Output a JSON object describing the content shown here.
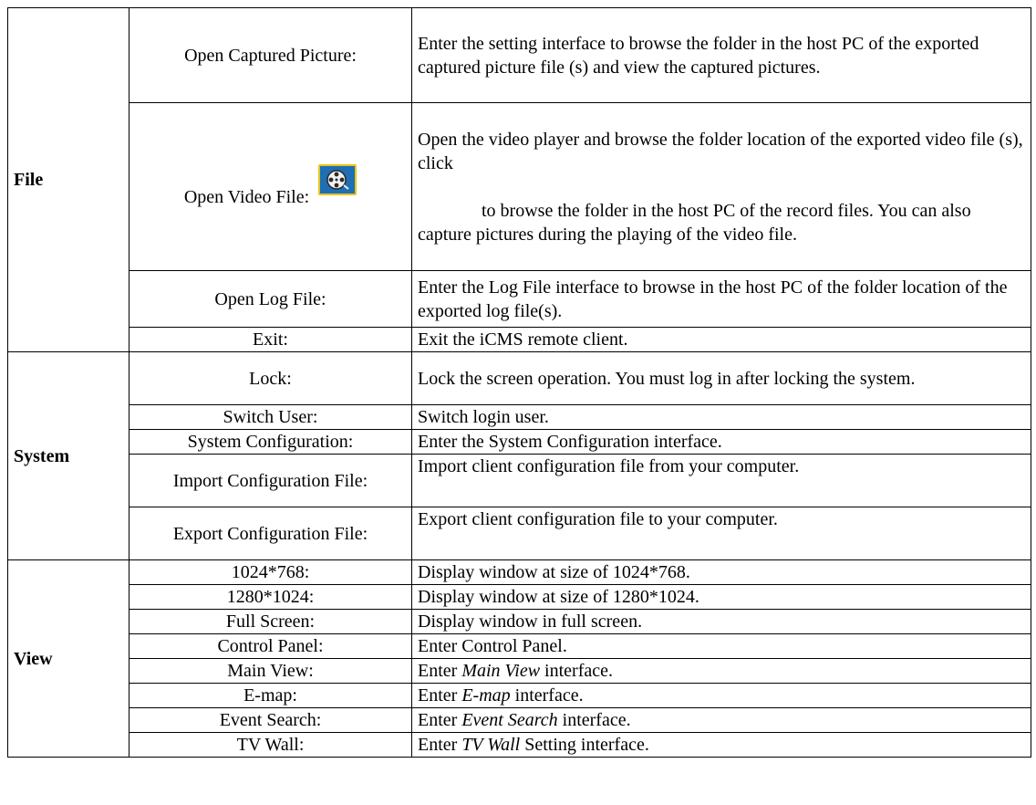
{
  "sections": {
    "file": {
      "title": "File",
      "rows": [
        {
          "item": "Open Captured Picture:",
          "desc": "Enter the setting interface to browse the folder in the host PC of the exported captured picture file (s) and view the captured pictures."
        },
        {
          "item": "Open Video File:",
          "desc_a": "Open the video player and browse the folder location of the exported video file (s), click",
          "desc_b": "to browse the folder in the host PC of the record files. You can also capture pictures during the playing of the video file.",
          "icon": "video-file-icon"
        },
        {
          "item": "Open Log File:",
          "desc": "Enter the Log File interface to browse in the host PC of the folder location of the exported log file(s)."
        },
        {
          "item": "Exit:",
          "desc": "Exit the iCMS remote client."
        }
      ]
    },
    "system": {
      "title": "System",
      "rows": [
        {
          "item": "Lock:",
          "desc": "Lock the screen operation. You must log in after locking the system."
        },
        {
          "item": "Switch User:",
          "desc": "Switch login user."
        },
        {
          "item": "System Configuration:",
          "desc": "Enter the System Configuration interface."
        },
        {
          "item": "Import Configuration File:",
          "desc": "Import client configuration file from your computer."
        },
        {
          "item": "Export Configuration File:",
          "desc": "Export client configuration file to your computer."
        }
      ]
    },
    "view": {
      "title": "View",
      "rows": [
        {
          "item": "1024*768:",
          "desc": "Display window at size of 1024*768."
        },
        {
          "item": "1280*1024:",
          "desc": "Display window at size of 1280*1024."
        },
        {
          "item": "Full Screen:",
          "desc": "Display window in full screen."
        },
        {
          "item": "Control Panel:",
          "desc": "Enter Control Panel."
        },
        {
          "item": "Main View:",
          "pre": "Enter ",
          "em": "Main View",
          "post": " interface."
        },
        {
          "item": "E-map:",
          "pre": "Enter ",
          "em": "E-map",
          "post": " interface."
        },
        {
          "item": "Event Search:",
          "pre": "Enter ",
          "em": "Event Search",
          "post": " interface."
        },
        {
          "item": "TV Wall:",
          "pre": "Enter ",
          "em": "TV Wall",
          "post": " Setting interface."
        }
      ]
    }
  }
}
